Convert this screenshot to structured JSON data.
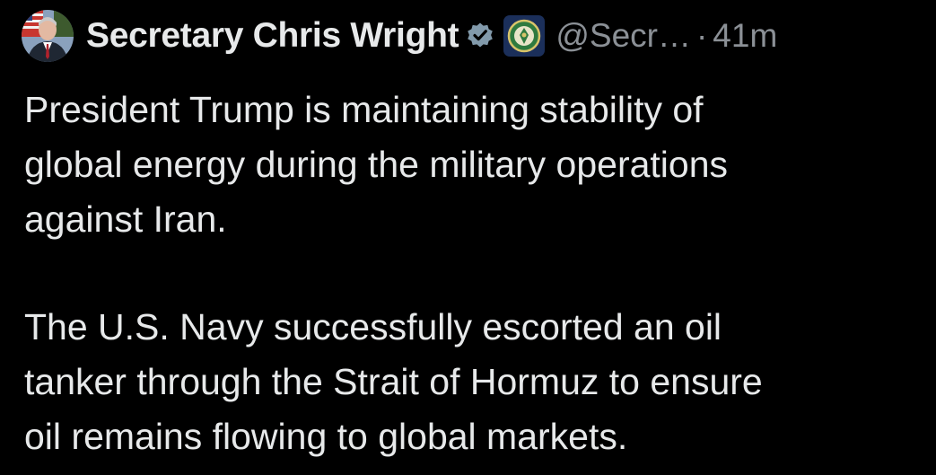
{
  "tweet": {
    "author": {
      "display_name": "Secretary Chris Wright",
      "handle": "@Secr…",
      "avatar_icon": "person-avatar-icon",
      "verified_icon": "verified-badge-icon",
      "affiliate_icon": "department-of-energy-seal-icon"
    },
    "separator": "·",
    "timestamp": "41m",
    "paragraphs": [
      "President Trump is maintaining stability of\nglobal energy during the military operations\nagainst Iran.",
      "The U.S. Navy successfully escorted an oil\ntanker through the Strait of Hormuz to ensure\noil remains flowing to global markets."
    ]
  },
  "colors": {
    "background": "#000000",
    "text_primary": "#e7e9ea",
    "text_secondary": "#8b9096",
    "verified_badge": "#829aab",
    "affiliate_background": "#1b2f5a"
  }
}
